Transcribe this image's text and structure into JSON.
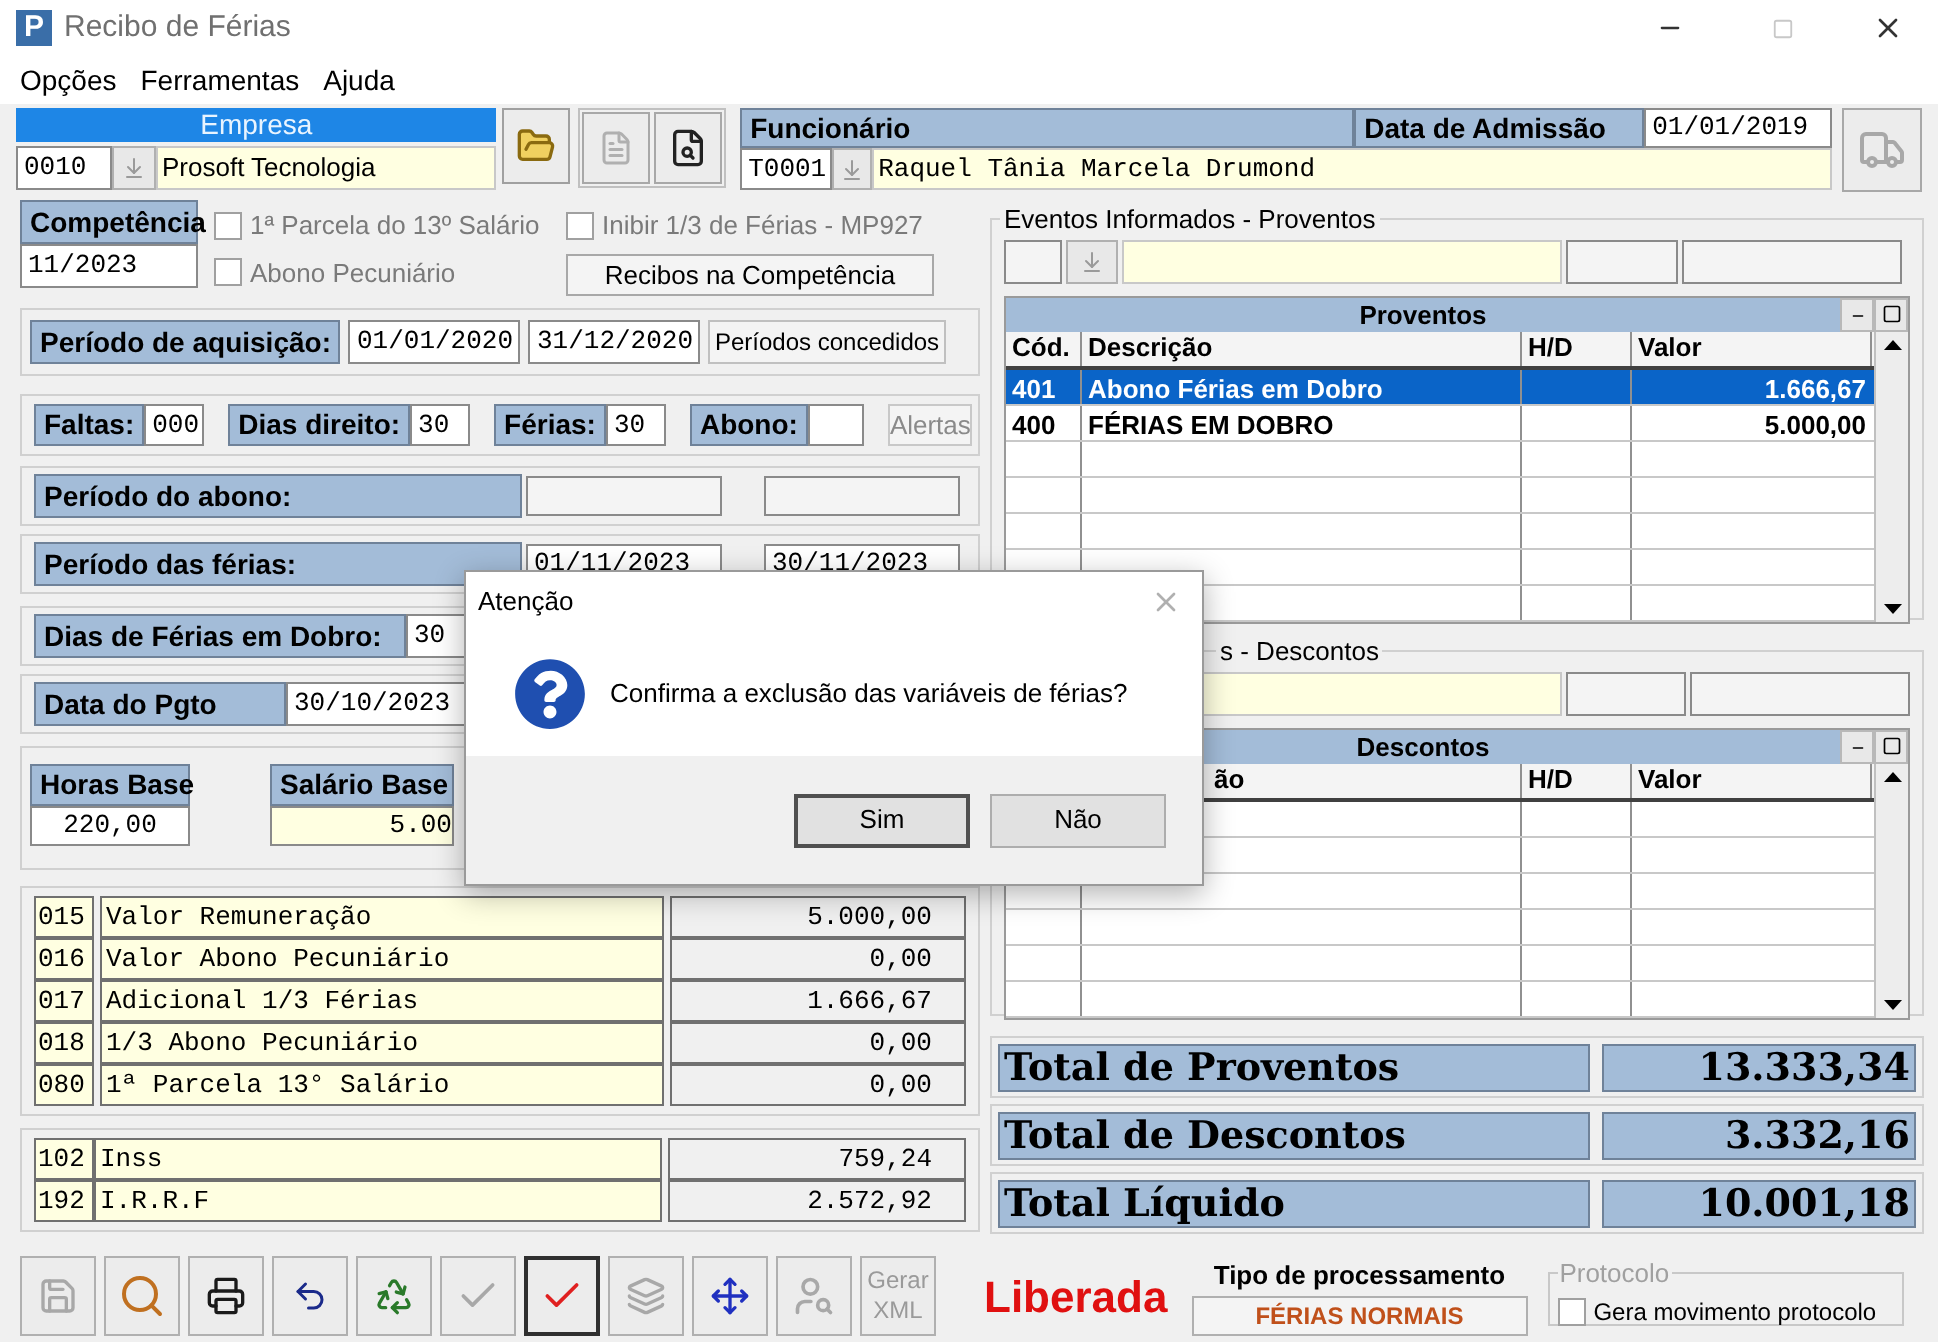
{
  "window": {
    "logo": "P",
    "title": "Recibo de Férias"
  },
  "menu": [
    "Opções",
    "Ferramentas",
    "Ajuda"
  ],
  "empresa": {
    "header": "Empresa",
    "code": "0010",
    "name": "Prosoft Tecnologia"
  },
  "funcionario": {
    "header": "Funcionário",
    "admission_label": "Data de Admissão",
    "admission_date": "01/01/2019",
    "code": "T0001",
    "name": "Raquel Tânia Marcela Drumond"
  },
  "competencia": {
    "label": "Competência",
    "value": "11/2023"
  },
  "options": [
    {
      "label": "1ª Parcela do 13º Salário",
      "checked": false,
      "disabled": true
    },
    {
      "label": "Abono Pecuniário",
      "checked": false,
      "disabled": true
    },
    {
      "label": "Inibir 1/3 de Férias - MP927",
      "checked": false,
      "disabled": true
    }
  ],
  "recibos_button": "Recibos na Competência",
  "aquisicao": {
    "label": "Período de aquisição:",
    "start": "01/01/2020",
    "end": "31/12/2020",
    "button": "Períodos concedidos"
  },
  "dias": [
    {
      "label": "Faltas:",
      "value": "000"
    },
    {
      "label": "Dias direito:",
      "value": "30"
    },
    {
      "label": "Férias:",
      "value": "30"
    },
    {
      "label": "Abono:"
    }
  ],
  "alertas": {
    "label": "Alertas",
    "disabled": true
  },
  "abono_periodo": {
    "label": "Período do abono:"
  },
  "ferias_periodo": {
    "label": "Período das férias:",
    "start": "01/11/2023",
    "end": "30/11/2023"
  },
  "dobro": {
    "label": "Dias de Férias em Dobro:",
    "value": "30"
  },
  "pagamento": {
    "label": "Data do Pgto",
    "value": "30/10/2023"
  },
  "base": {
    "horas_label": "Horas Base",
    "horas": "220,00",
    "salario_label": "Salário Base",
    "salario": "5.00"
  },
  "valores": [
    {
      "code": "015",
      "description": "Valor Remuneração",
      "value": "5.000,00"
    },
    {
      "code": "016",
      "description": "Valor Abono Pecuniário",
      "value": "0,00"
    },
    {
      "code": "017",
      "description": "Adicional 1/3 Férias",
      "value": "1.666,67"
    },
    {
      "code": "018",
      "description": "1/3 Abono Pecuniário",
      "value": "0,00"
    },
    {
      "code": "080",
      "description": "1ª Parcela 13° Salário",
      "value": "0,00"
    }
  ],
  "descontos_valores": [
    {
      "code": "102",
      "description": "Inss",
      "value": "759,24"
    },
    {
      "code": "192",
      "description": "I.R.R.F",
      "value": "2.572,92"
    }
  ],
  "proventos_box": {
    "legend": "Eventos Informados - Proventos",
    "table_title": "Proventos",
    "columns": [
      "Cód.",
      "Descrição",
      "H/D",
      "Valor"
    ],
    "rows": [
      {
        "code": "401",
        "description": "Abono Férias em Dobro",
        "value": "1.666,67",
        "selected": true
      },
      {
        "code": "400",
        "description": "FÉRIAS EM DOBRO",
        "value": "5.000,00",
        "selected": false
      }
    ]
  },
  "descontos_box": {
    "legend": "s - Descontos",
    "table_title": "Descontos",
    "columns": [
      "ão",
      "H/D",
      "Valor"
    ]
  },
  "totals": [
    {
      "label": "Total de Proventos",
      "value": "13.333,34"
    },
    {
      "label": "Total de Descontos",
      "value": "3.332,16"
    },
    {
      "label": "Total Líquido",
      "value": "10.001,18"
    }
  ],
  "toolbar": [
    {
      "kind": "save",
      "disabled": true,
      "focused": false
    },
    {
      "kind": "search",
      "disabled": false,
      "focused": false
    },
    {
      "kind": "print",
      "disabled": false,
      "focused": false
    },
    {
      "kind": "undo",
      "disabled": false,
      "focused": false
    },
    {
      "kind": "recycle",
      "disabled": false,
      "focused": false
    },
    {
      "kind": "check",
      "disabled": true,
      "focused": false
    },
    {
      "kind": "check",
      "disabled": false,
      "focused": true
    },
    {
      "kind": "layers",
      "disabled": true,
      "focused": false
    },
    {
      "kind": "move",
      "disabled": false,
      "focused": false
    },
    {
      "kind": "user",
      "disabled": true,
      "focused": false
    },
    {
      "kind": "text",
      "label": "Gerar XML",
      "disabled": true,
      "focused": false
    }
  ],
  "status": "Liberada",
  "processamento": {
    "label": "Tipo de processamento",
    "value": "FÉRIAS NORMAIS"
  },
  "protocolo": {
    "legend": "Protocolo",
    "checkbox_label": "Gera movimento protocolo",
    "checked": false
  },
  "dialog": {
    "title": "Atenção",
    "message": "Confirma a exclusão das variáveis de férias?",
    "buttons": [
      "Sim",
      "Não"
    ]
  }
}
